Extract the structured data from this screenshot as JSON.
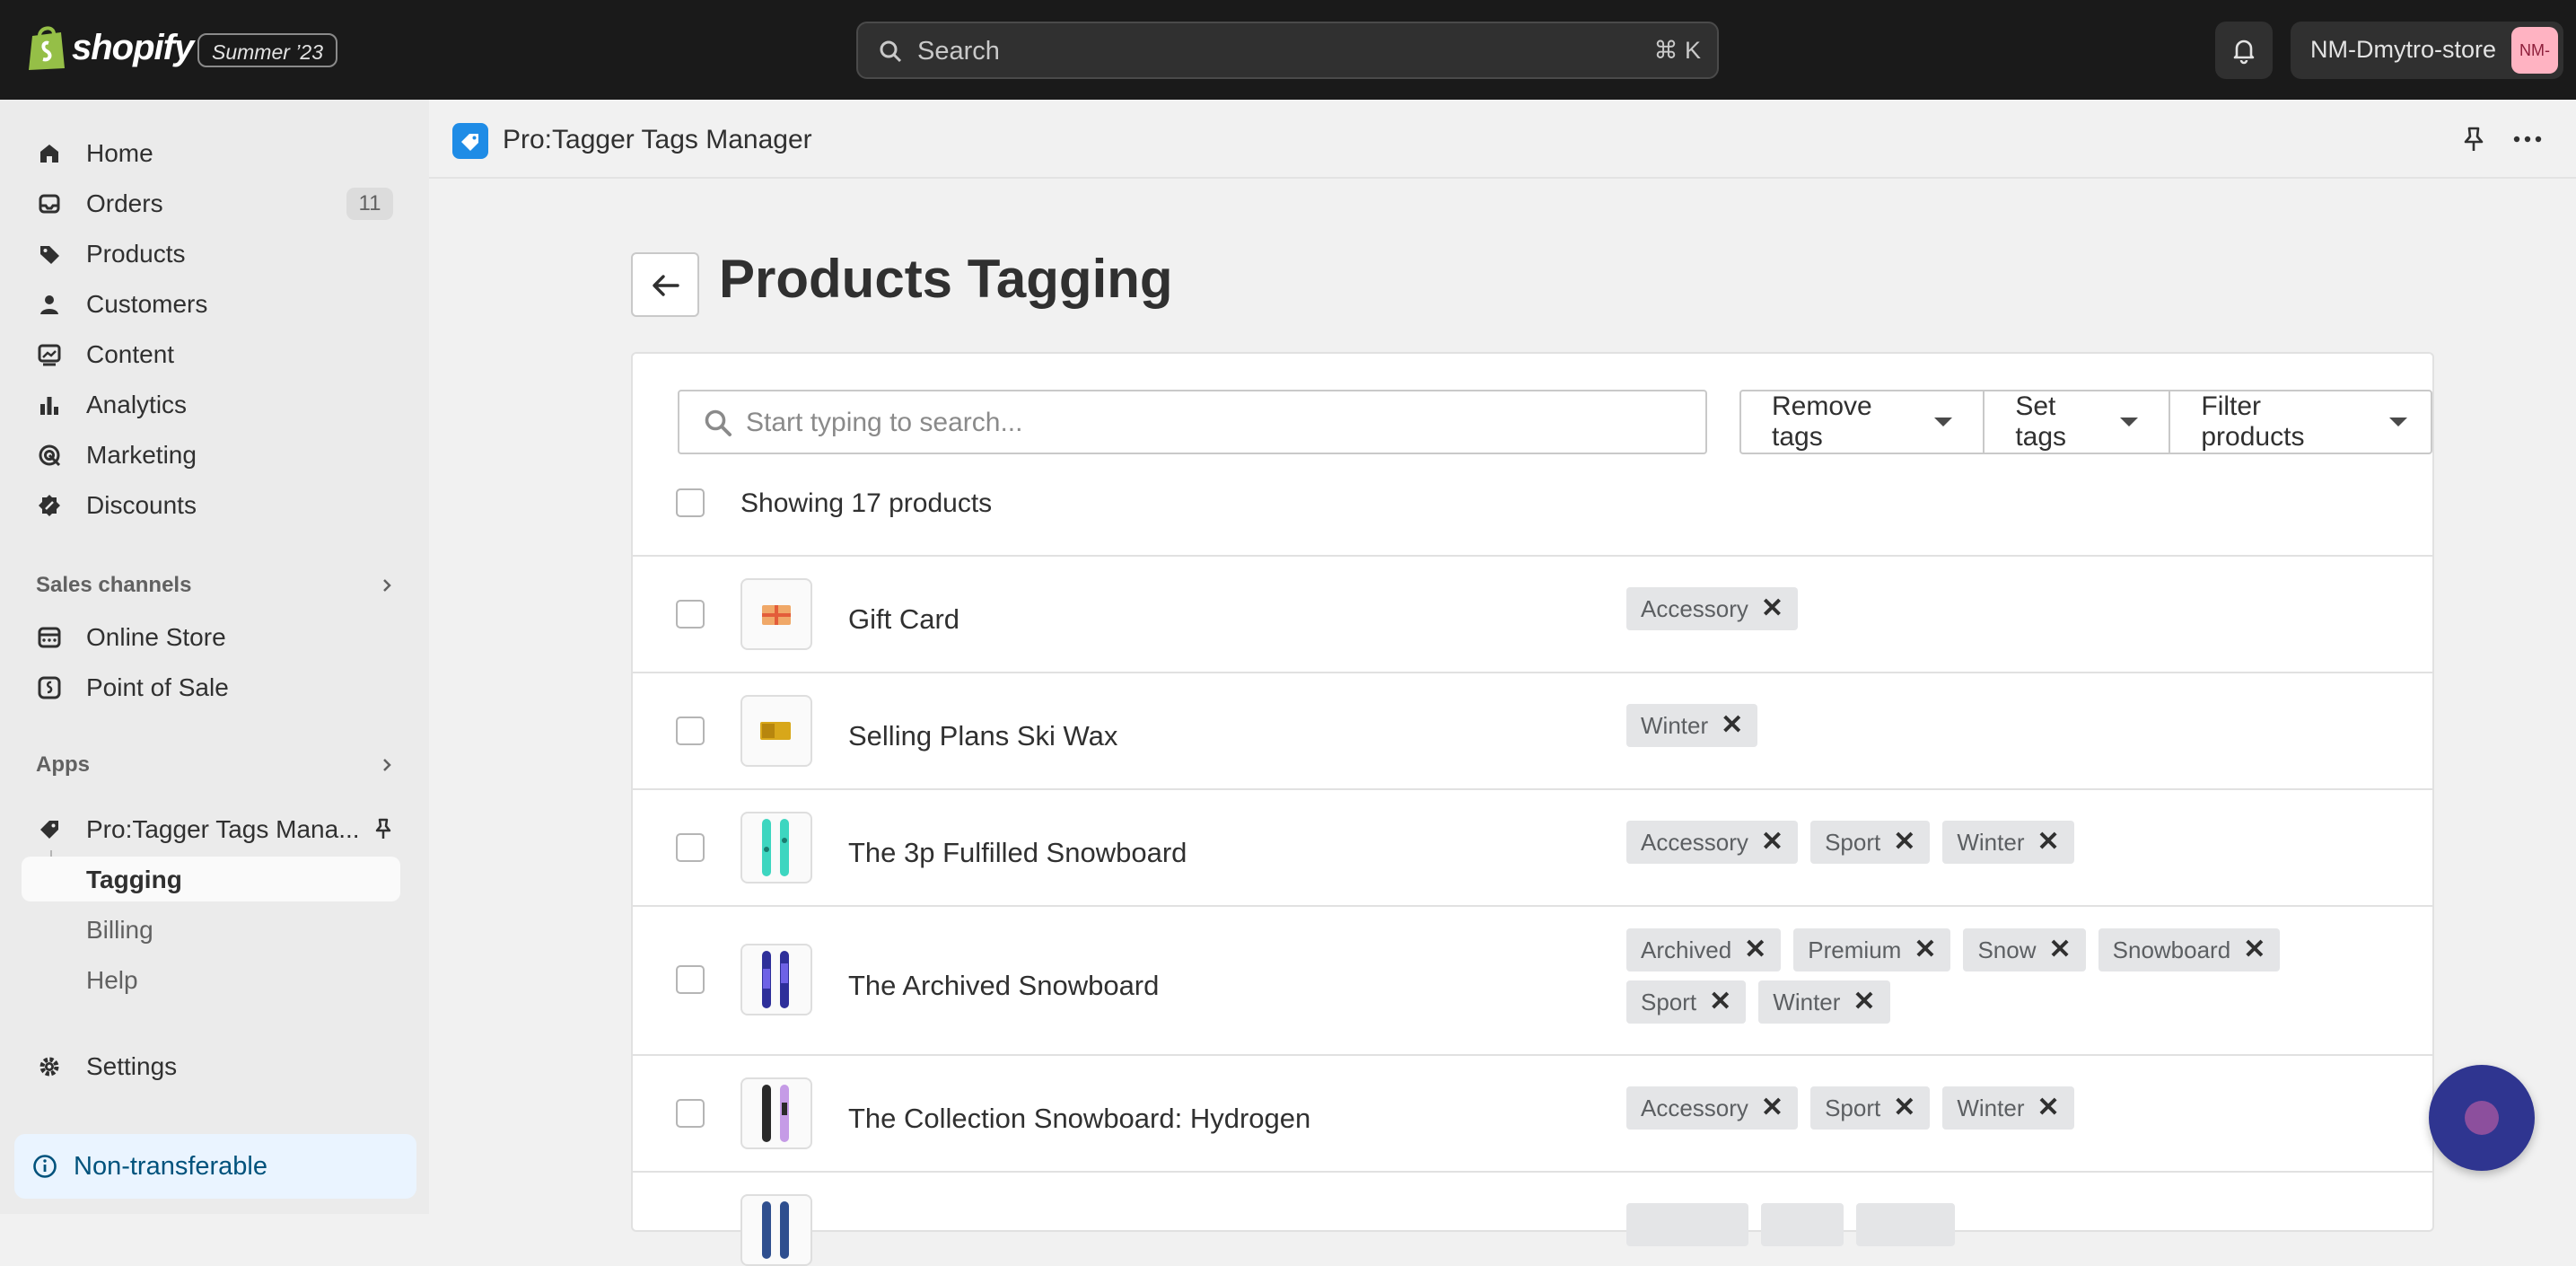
{
  "topbar": {
    "brand": "shopify",
    "edition_badge": "Summer ’23",
    "search_label": "Search",
    "search_shortcut": "⌘ K",
    "store_name": "NM-Dmytro-store",
    "store_avatar": "NM-"
  },
  "sidebar": {
    "items": [
      {
        "label": "Home",
        "icon": "home-icon"
      },
      {
        "label": "Orders",
        "icon": "inbox-icon",
        "count": "11"
      },
      {
        "label": "Products",
        "icon": "tag-icon"
      },
      {
        "label": "Customers",
        "icon": "person-icon"
      },
      {
        "label": "Content",
        "icon": "image-icon"
      },
      {
        "label": "Analytics",
        "icon": "bar-chart-icon"
      },
      {
        "label": "Marketing",
        "icon": "target-icon"
      },
      {
        "label": "Discounts",
        "icon": "discount-icon"
      }
    ],
    "sales_channels_heading": "Sales channels",
    "sales_channels": [
      {
        "label": "Online Store",
        "icon": "store-icon"
      },
      {
        "label": "Point of Sale",
        "icon": "pos-icon"
      }
    ],
    "apps_heading": "Apps",
    "app_name": "Pro:Tagger Tags Mana...",
    "app_subitems": [
      "Tagging",
      "Billing",
      "Help"
    ],
    "settings_label": "Settings",
    "notice_label": "Non-transferable"
  },
  "app_header": {
    "title": "Pro:Tagger Tags Manager"
  },
  "main": {
    "page_title": "Products Tagging",
    "search_placeholder": "Start typing to search...",
    "buttons": [
      "Remove tags",
      "Set tags",
      "Filter products"
    ],
    "showing_text": "Showing 17 products",
    "products": [
      {
        "name": "Gift Card",
        "tags": [
          "Accessory"
        ]
      },
      {
        "name": "Selling Plans Ski Wax",
        "tags": [
          "Winter"
        ]
      },
      {
        "name": "The 3p Fulfilled Snowboard",
        "tags": [
          "Accessory",
          "Sport",
          "Winter"
        ]
      },
      {
        "name": "The Archived Snowboard",
        "tags": [
          "Archived",
          "Premium",
          "Snow",
          "Snowboard",
          "Sport",
          "Winter"
        ]
      },
      {
        "name": "The Collection Snowboard: Hydrogen",
        "tags": [
          "Accessory",
          "Sport",
          "Winter"
        ]
      }
    ],
    "tag_remove_glyph": "✕"
  },
  "colors": {
    "topbar_bg": "#1a1a1a",
    "sidebar_bg": "#ebebeb",
    "page_bg": "#f1f1f1",
    "tag_bg": "#e4e5e7",
    "notice_bg": "#eaf4ff",
    "chat_button": "#2f3590"
  }
}
